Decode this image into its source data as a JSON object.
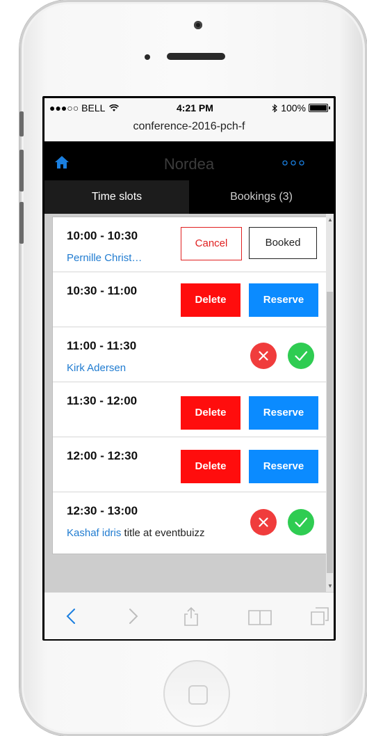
{
  "status_bar": {
    "carrier": "●●●○○ BELL",
    "time": "4:21 PM",
    "battery": "100%"
  },
  "url_bar": {
    "url": "conference-2016-pch-f"
  },
  "app_header": {
    "title": "Nordea"
  },
  "tabs": [
    {
      "label": "Time slots"
    },
    {
      "label": "Bookings (3)"
    }
  ],
  "slots": [
    {
      "time": "10:00 - 10:30",
      "name": "Pernille Christ…",
      "actions": [
        "Cancel",
        "Booked"
      ]
    },
    {
      "time": "10:30 - 11:00",
      "actions": [
        "Delete",
        "Reserve"
      ]
    },
    {
      "time": "11:00 - 11:30",
      "name": "Kirk Adersen"
    },
    {
      "time": "11:30 - 12:00",
      "actions": [
        "Delete",
        "Reserve"
      ]
    },
    {
      "time": "12:00 - 12:30",
      "actions": [
        "Delete",
        "Reserve"
      ]
    },
    {
      "time": "12:30 - 13:00",
      "name": "Kashaf idris",
      "name_extra": "title at eventbuizz"
    }
  ],
  "colors": {
    "accent_blue": "#0b8bff",
    "link_blue": "#1f7bd0",
    "delete_red": "#ff0d0d",
    "decline_red": "#f03c3c",
    "approve_green": "#2fcc52"
  },
  "icons": [
    "home-icon",
    "more-icon",
    "close-icon",
    "check-icon",
    "back-icon",
    "forward-icon",
    "share-icon",
    "bookmarks-icon",
    "tabs-icon",
    "bluetooth-icon",
    "wifi-icon",
    "battery-icon"
  ]
}
